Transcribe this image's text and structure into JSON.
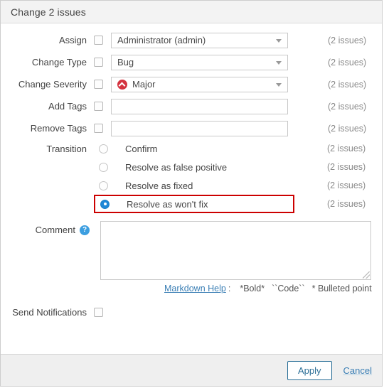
{
  "dialog": {
    "title": "Change 2 issues"
  },
  "form": {
    "rows": [
      {
        "label": "Assign",
        "control": "select",
        "value": "Administrator (admin)",
        "issues": "(2 issues)"
      },
      {
        "label": "Change Type",
        "control": "select",
        "value": "Bug",
        "issues": "(2 issues)"
      },
      {
        "label": "Change Severity",
        "control": "select",
        "value": "Major",
        "icon": "severity-major-icon",
        "issues": "(2 issues)"
      },
      {
        "label": "Add Tags",
        "control": "text",
        "value": "",
        "issues": "(2 issues)"
      },
      {
        "label": "Remove Tags",
        "control": "text",
        "value": "",
        "issues": "(2 issues)"
      }
    ]
  },
  "transition": {
    "label": "Transition",
    "options": [
      {
        "label": "Confirm",
        "selected": false,
        "issues": "(2 issues)"
      },
      {
        "label": "Resolve as false positive",
        "selected": false,
        "issues": "(2 issues)"
      },
      {
        "label": "Resolve as fixed",
        "selected": false,
        "issues": "(2 issues)"
      },
      {
        "label": "Resolve as won't fix",
        "selected": true,
        "issues": "(2 issues)"
      }
    ]
  },
  "comment": {
    "label": "Comment",
    "help_icon_glyph": "?",
    "value": "",
    "markdown": {
      "link_text": "Markdown Help",
      "separator": ":",
      "hints": [
        "*Bold*",
        "``Code``",
        "* Bulleted point"
      ]
    }
  },
  "notifications": {
    "label": "Send Notifications",
    "checked": false
  },
  "footer": {
    "apply_label": "Apply",
    "cancel_label": "Cancel"
  },
  "colors": {
    "accent_blue": "#1e87d6",
    "link_blue": "#3b7fb5",
    "severity_red": "#d4333f",
    "highlight_red": "#cc0000",
    "header_bg": "#f3f3f3",
    "footer_bg": "#efefef"
  }
}
